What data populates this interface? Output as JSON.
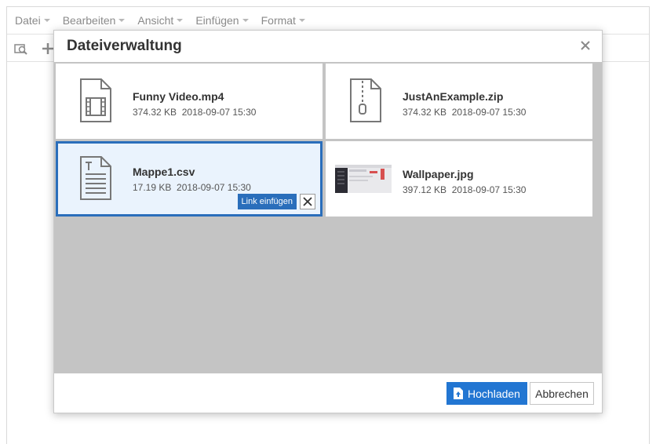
{
  "menubar": {
    "items": [
      {
        "label": "Datei"
      },
      {
        "label": "Bearbeiten"
      },
      {
        "label": "Ansicht"
      },
      {
        "label": "Einfügen"
      },
      {
        "label": "Format"
      }
    ]
  },
  "toolbar": {
    "icons": [
      "image-search-icon",
      "plus-icon"
    ]
  },
  "dialog": {
    "title": "Dateiverwaltung",
    "files": [
      {
        "name": "Funny Video.mp4",
        "size": "374.32 KB",
        "date": "2018-09-07 15:30",
        "icon": "video-file-icon"
      },
      {
        "name": "JustAnExample.zip",
        "size": "374.32 KB",
        "date": "2018-09-07 15:30",
        "icon": "zip-file-icon"
      },
      {
        "name": "Mappe1.csv",
        "size": "17.19 KB",
        "date": "2018-09-07 15:30",
        "icon": "text-file-icon",
        "selected": true
      },
      {
        "name": "Wallpaper.jpg",
        "size": "397.12 KB",
        "date": "2018-09-07 15:30",
        "icon": "image-thumbnail"
      }
    ],
    "selected_actions": {
      "insert_link": "Link einfügen"
    },
    "footer": {
      "upload": "Hochladen",
      "cancel": "Abbrechen"
    }
  },
  "colors": {
    "accent": "#2276d2",
    "selected_border": "#2a6ebb",
    "selected_bg": "#eaf3fd",
    "body_bg": "#c4c4c4"
  }
}
